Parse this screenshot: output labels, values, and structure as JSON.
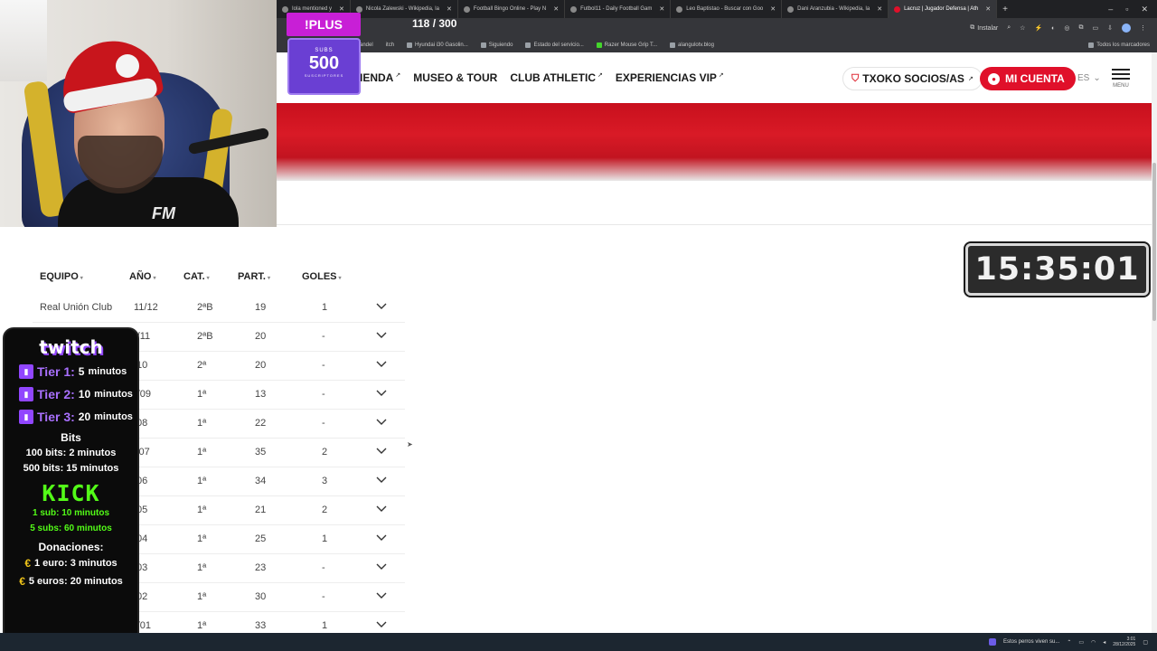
{
  "browser": {
    "tabs": [
      {
        "label": "Iola mentioned y"
      },
      {
        "label": "Nicola Zalewski - Wikipedia, la"
      },
      {
        "label": "Football Bingo Online - Play N"
      },
      {
        "label": "Futbol11 - Daily Football Gam"
      },
      {
        "label": "Leo Baptistao - Buscar con Goo"
      },
      {
        "label": "Dani Aranzubia - Wikipedia, la"
      },
      {
        "label": "Lacruz | Jugador Defensa | Ath"
      }
    ],
    "new_tab": "+",
    "install_label": "Instalar",
    "bookmarks": [
      {
        "label": "andel"
      },
      {
        "label": "itch"
      },
      {
        "label": "Hyundai i30 Gasolin..."
      },
      {
        "label": "Siguiendo"
      },
      {
        "label": "Estado del servicio..."
      },
      {
        "label": "Razer Mouse Grip T..."
      },
      {
        "label": "alangulotv.blog"
      }
    ],
    "all_bookmarks": "Todos los marcadores"
  },
  "site": {
    "nav": [
      {
        "label": "IENDA"
      },
      {
        "label": "MUSEO & TOUR"
      },
      {
        "label": "CLUB ATHLETIC"
      },
      {
        "label": "EXPERIENCIAS VIP"
      }
    ],
    "nav_arrow": "↗",
    "txoko": "TXOKO SOCIOS/AS",
    "account": "MI CUENTA",
    "lang": "ES",
    "menu": "MENU",
    "colors": {
      "accent": "#e0102a",
      "banner": "#c8101d"
    }
  },
  "table": {
    "headers": {
      "team": "EQUIPO",
      "year": "AÑO",
      "cat": "CAT.",
      "part": "PART.",
      "goals": "GOLES"
    },
    "rows": [
      {
        "team": "Real Unión Club",
        "year": "11/12",
        "cat": "2ªB",
        "part": "19",
        "goals": "1"
      },
      {
        "team": "",
        "year": ")/11",
        "cat": "2ªB",
        "part": "20",
        "goals": "-"
      },
      {
        "team": "",
        "year": "/10",
        "cat": "2ª",
        "part": "20",
        "goals": "-"
      },
      {
        "team": "",
        "year": "-/09",
        "cat": "1ª",
        "part": "13",
        "goals": "-"
      },
      {
        "team": "",
        "year": "/08",
        "cat": "1ª",
        "part": "22",
        "goals": "-"
      },
      {
        "team": "",
        "year": "j/07",
        "cat": "1ª",
        "part": "35",
        "goals": "2"
      },
      {
        "team": "",
        "year": "/06",
        "cat": "1ª",
        "part": "34",
        "goals": "3"
      },
      {
        "team": "",
        "year": "/05",
        "cat": "1ª",
        "part": "21",
        "goals": "2"
      },
      {
        "team": "",
        "year": "/04",
        "cat": "1ª",
        "part": "25",
        "goals": "1"
      },
      {
        "team": "",
        "year": "/03",
        "cat": "1ª",
        "part": "23",
        "goals": "-"
      },
      {
        "team": "",
        "year": "/02",
        "cat": "1ª",
        "part": "30",
        "goals": "-"
      },
      {
        "team": "",
        "year": ")/01",
        "cat": "1ª",
        "part": "33",
        "goals": "1"
      }
    ]
  },
  "overlay": {
    "plus": "!PLUS",
    "counter": "118 / 300",
    "subs_label": "SUBS",
    "subs_value": "500",
    "subs_caption": "SUSCRIPTORES",
    "timer": "15:35:01",
    "webcam_shirt": "FM",
    "twitch_logo": "twitch",
    "tiers": [
      {
        "name": "Tier 1:",
        "amount": "5",
        "unit": "minutos"
      },
      {
        "name": "Tier 2:",
        "amount": "10",
        "unit": "minutos"
      },
      {
        "name": "Tier 3:",
        "amount": "20",
        "unit": "minutos"
      }
    ],
    "bits_heading": "Bits",
    "bits": [
      "100 bits: 2 minutos",
      "500 bits: 15 minutos"
    ],
    "kick_logo": "KICK",
    "kick": [
      "1 sub: 10 minutos",
      "5 subs: 60 minutos"
    ],
    "donations_heading": "Donaciones:",
    "donations": [
      "1 euro: 3 minutos",
      "5 euros: 20 minutos"
    ],
    "colors": {
      "twitch": "#9146ff",
      "kick": "#53fc18",
      "plus": "#c81fd6",
      "subs": "#6a3fd3"
    }
  },
  "taskbar": {
    "notification": "Estos perros viven su...",
    "time": "3:01",
    "date": "28/12/2025"
  }
}
